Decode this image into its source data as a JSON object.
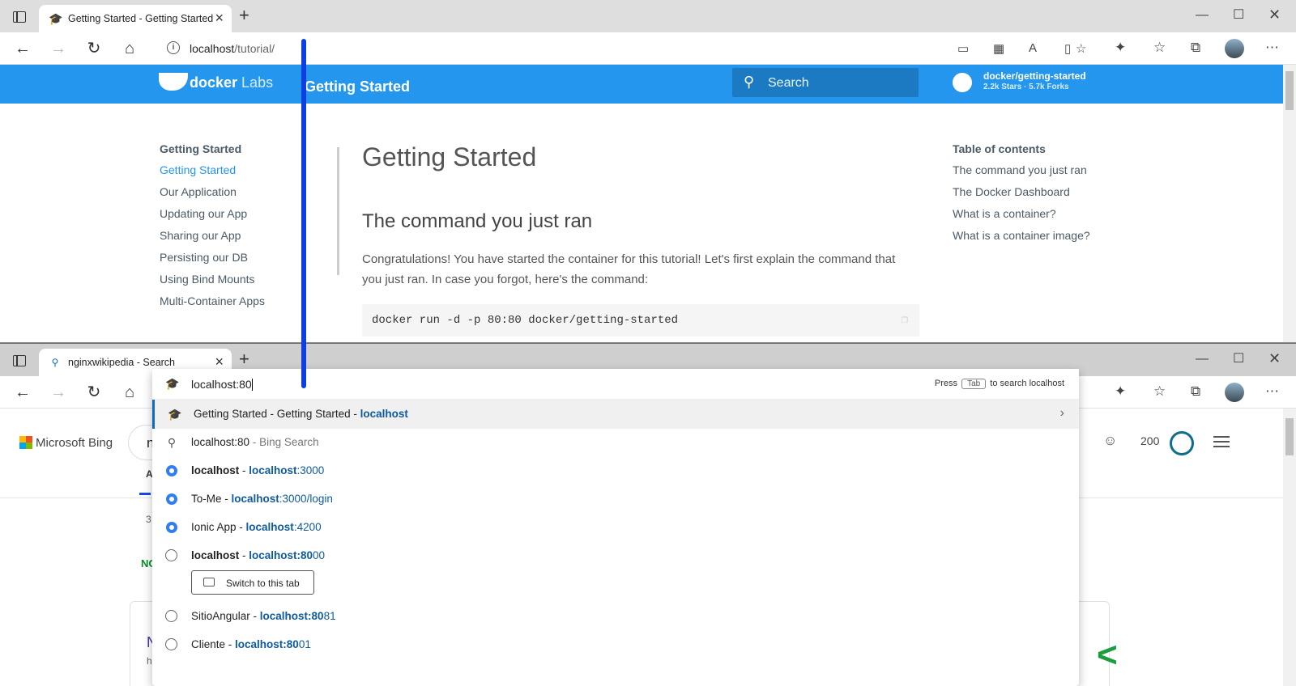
{
  "window1": {
    "tab_title": "Getting Started - Getting Started",
    "address": {
      "host": "localhost",
      "path": "/tutorial/"
    },
    "docker": {
      "logo_main": "docker",
      "logo_sub": "Labs",
      "title": "Getting Started",
      "search_placeholder": "Search",
      "repo_name": "docker/getting-started",
      "repo_stats": "2.2k Stars · 5.7k Forks",
      "nav_heading": "Getting Started",
      "nav_items": [
        "Getting Started",
        "Our Application",
        "Updating our App",
        "Sharing our App",
        "Persisting our DB",
        "Using Bind Mounts",
        "Multi-Container Apps"
      ],
      "h1": "Getting Started",
      "h2": "The command you just ran",
      "paragraph": "Congratulations! You have started the container for this tutorial! Let's first explain the command that you just ran. In case you forgot, here's the command:",
      "code": "docker run -d -p 80:80 docker/getting-started",
      "toc_heading": "Table of contents",
      "toc_items": [
        "The command you just ran",
        "The Docker Dashboard",
        "What is a container?",
        "What is a container image?"
      ]
    }
  },
  "window2": {
    "tab_title": "nginxwikipedia - Search",
    "address_input": "localhost:80",
    "hint_press": "Press",
    "hint_key": "Tab",
    "hint_rest": "to search localhost",
    "bing": {
      "logo": "Microsoft Bing",
      "reward_count": "200",
      "partial_search": "n",
      "partial_a": "A",
      "partial_3": "3",
      "partial_no": "NO",
      "partial_n": "N",
      "partial_h": "h"
    },
    "suggestions": [
      {
        "title": "Getting Started - Getting Started",
        "sep": " - ",
        "url_bold": "localhost",
        "url_rest": ""
      },
      {
        "title": "localhost:80",
        "sep": " - ",
        "extra": "Bing Search"
      },
      {
        "title": "localhost",
        "sep": " - ",
        "url_bold": "localhost",
        "url_rest": ":3000"
      },
      {
        "title": "To-Me",
        "sep": " - ",
        "url_bold": "localhost",
        "url_rest": ":3000/login"
      },
      {
        "title": "Ionic App",
        "sep": " - ",
        "url_bold": "localhost",
        "url_rest": ":4200"
      },
      {
        "title": "localhost",
        "sep": " - ",
        "url_bold": "localhost:80",
        "url_rest": "00"
      },
      {
        "title": "SitioAngular",
        "sep": " - ",
        "url_bold": "localhost:80",
        "url_rest": "81"
      },
      {
        "title": "Cliente",
        "sep": " - ",
        "url_bold": "localhost:80",
        "url_rest": "01"
      }
    ],
    "switch_tab_label": "Switch to this tab"
  },
  "colors": {
    "docker_blue": "#2496ed",
    "edge_link": "#0e5a9e",
    "annotation_line": "#0e3fe0"
  },
  "icons": [
    "tab-actions-icon",
    "graduation-cap-icon",
    "close-icon",
    "plus-icon",
    "minimize-icon",
    "maximize-icon",
    "back-icon",
    "forward-icon",
    "refresh-icon",
    "home-icon",
    "info-icon",
    "favorites-star-icon",
    "extensions-icon",
    "collections-icon",
    "more-icon",
    "search-icon",
    "github-icon",
    "copy-icon",
    "globe-icon",
    "history-ring-icon",
    "chevron-right-icon"
  ]
}
